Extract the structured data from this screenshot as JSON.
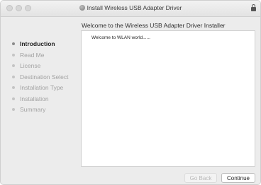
{
  "window": {
    "title": "Install Wireless USB Adapter Driver"
  },
  "header": {
    "text": "Welcome to the Wireless USB Adapter Driver Installer"
  },
  "sidebar": {
    "steps": [
      {
        "label": "Introduction",
        "active": true
      },
      {
        "label": "Read Me",
        "active": false
      },
      {
        "label": "License",
        "active": false
      },
      {
        "label": "Destination Select",
        "active": false
      },
      {
        "label": "Installation Type",
        "active": false
      },
      {
        "label": "Installation",
        "active": false
      },
      {
        "label": "Summary",
        "active": false
      }
    ]
  },
  "content": {
    "text": "Welcome to WLAN world......"
  },
  "buttons": {
    "back_label": "Go Back",
    "back_enabled": false,
    "continue_label": "Continue"
  },
  "icons": {
    "title": "installer-package-icon",
    "lock": "lock-icon"
  }
}
